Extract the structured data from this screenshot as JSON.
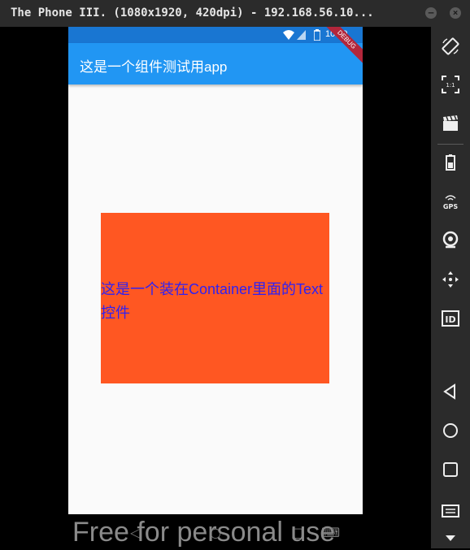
{
  "window": {
    "title": "The Phone III. (1080x1920, 420dpi) - 192.168.56.10...",
    "minimize": "–",
    "close": "×"
  },
  "status_bar": {
    "time": "10:09"
  },
  "app_bar": {
    "title": "这是一个组件测试用app"
  },
  "debug_banner": "DEBUG",
  "container": {
    "text": "这是一个装在Container里面的Text控件",
    "background": "#ff5722",
    "text_color": "#2f21f3"
  },
  "sidebar_icons": [
    "rotate-icon",
    "fullscreen-icon",
    "screen-record-icon",
    "battery-icon",
    "gps-icon",
    "camera-icon",
    "move-icon",
    "identifiers-icon",
    "back-icon",
    "home-icon",
    "recents-icon",
    "menu-icon",
    "chevron-down-icon"
  ],
  "sidebar_labels": {
    "fullscreen": "1:1",
    "gps": "GPS",
    "id": "ID"
  },
  "watermark": "Free for personal use"
}
